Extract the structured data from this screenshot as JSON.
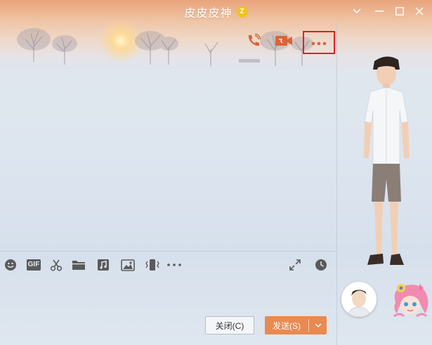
{
  "window": {
    "title": "皮皮皮神",
    "badge_icon": "vip-badge-icon",
    "controls": [
      "chevron-down-icon",
      "minimize-icon",
      "maximize-icon",
      "close-icon"
    ]
  },
  "top_actions": {
    "voice_call_icon": "phone-call-icon",
    "video_call_icon": "video-camera-icon",
    "more_icon": "more-dots-icon",
    "accent": "#d9643a",
    "highlight_color": "#e31e24"
  },
  "input_toolbar": {
    "icons": [
      "emoji-icon",
      "gif-icon",
      "scissors-icon",
      "folder-icon",
      "music-icon",
      "image-icon",
      "vibrate-icon",
      "more-dots-icon"
    ],
    "gif_label": "GIF",
    "right_icons": [
      "expand-icon",
      "history-clock-icon"
    ]
  },
  "buttons": {
    "close_label": "关闭(C)",
    "send_label": "发送(S)",
    "send_color": "#e98a50"
  },
  "sidebar": {
    "show_avatar": "avatar-3d-male",
    "contact_avatar": "avatar-small",
    "pet": "pet-anime-character"
  }
}
